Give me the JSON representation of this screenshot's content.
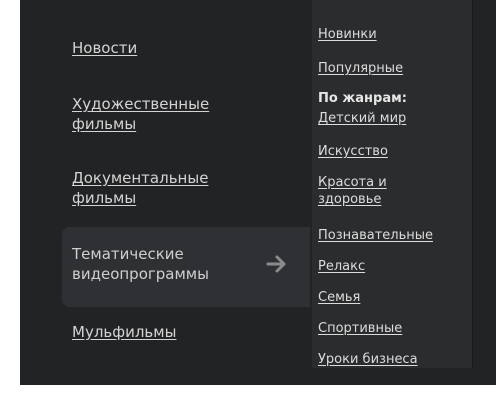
{
  "main_menu": {
    "items": [
      {
        "label_lines": [
          "Новости"
        ]
      },
      {
        "label_lines": [
          "Художественные",
          "фильмы"
        ]
      },
      {
        "label_lines": [
          "Документальные",
          "фильмы"
        ]
      },
      {
        "label_lines": [
          "Тематические",
          "видеопрограммы"
        ]
      },
      {
        "label_lines": [
          "Мульфильмы"
        ]
      }
    ],
    "active_icon": "arrow-right-icon"
  },
  "submenu": {
    "top_items": [
      "Новинки",
      "Популярные"
    ],
    "genres_heading": "По жанрам:",
    "genre_items": [
      {
        "label_lines": [
          "Детский мир"
        ]
      },
      {
        "label_lines": [
          "Искусство"
        ]
      },
      {
        "label_lines": [
          "Красота и",
          "здоровье"
        ]
      },
      {
        "label_lines": [
          "Познавательные"
        ]
      },
      {
        "label_lines": [
          "Релакс"
        ]
      },
      {
        "label_lines": [
          "Семья"
        ]
      },
      {
        "label_lines": [
          "Спортивные"
        ]
      },
      {
        "label_lines": [
          "Уроки бизнеса"
        ]
      }
    ]
  },
  "colors": {
    "panel_bg": "#222325",
    "submenu_bg": "#2b2c2e",
    "active_bg": "#2f3033",
    "text": "#d4d4d4"
  }
}
